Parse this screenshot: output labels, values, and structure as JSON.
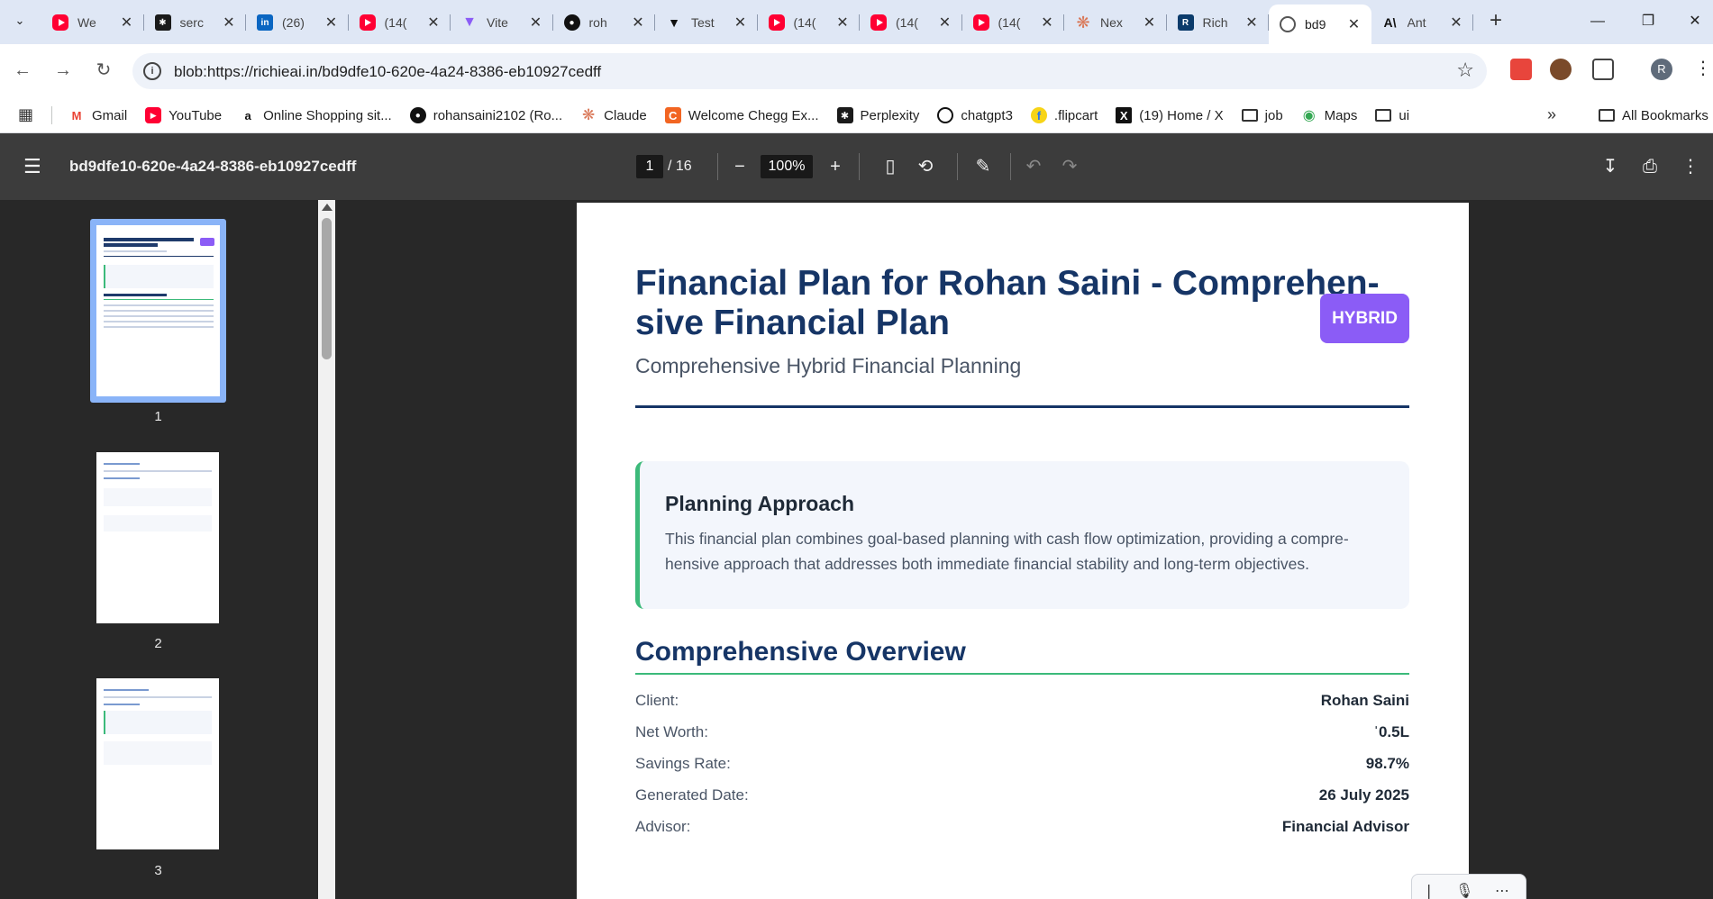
{
  "tabs": [
    {
      "title": "We",
      "icon": "youtube-icon"
    },
    {
      "title": "serc",
      "icon": "perplexity-icon"
    },
    {
      "title": "(26)",
      "icon": "linkedin-icon"
    },
    {
      "title": "(14(",
      "icon": "youtube-icon"
    },
    {
      "title": "Vite",
      "icon": "vite-icon"
    },
    {
      "title": "roh",
      "icon": "github-icon"
    },
    {
      "title": "Test",
      "icon": "test-icon"
    },
    {
      "title": "(14(",
      "icon": "youtube-icon"
    },
    {
      "title": "(14(",
      "icon": "youtube-icon"
    },
    {
      "title": "(14(",
      "icon": "youtube-icon"
    },
    {
      "title": "Nex",
      "icon": "claude-icon"
    },
    {
      "title": "Rich",
      "icon": "richieai-icon"
    },
    {
      "title": "bd9",
      "icon": "globe-icon",
      "active": true
    },
    {
      "title": "Ant",
      "icon": "anthropic-icon"
    }
  ],
  "address_bar": {
    "url": "blob:https://richieai.in/bd9dfe10-620e-4a24-8386-eb10927cedff"
  },
  "bookmarks": [
    {
      "label": "Gmail",
      "icon": "gmail-icon"
    },
    {
      "label": "YouTube",
      "icon": "youtube-icon"
    },
    {
      "label": "Online Shopping sit...",
      "icon": "amazon-icon"
    },
    {
      "label": "rohansaini2102 (Ro...",
      "icon": "github-icon"
    },
    {
      "label": "Claude",
      "icon": "claude-icon"
    },
    {
      "label": "Welcome Chegg Ex...",
      "icon": "chegg-icon"
    },
    {
      "label": "Perplexity",
      "icon": "perplexity-icon"
    },
    {
      "label": "chatgpt3",
      "icon": "openai-icon"
    },
    {
      "label": ".flipcart",
      "icon": "flipkart-icon"
    },
    {
      "label": "(19) Home / X",
      "icon": "x-icon"
    },
    {
      "label": "job",
      "icon": "folder-icon"
    },
    {
      "label": "Maps",
      "icon": "maps-icon"
    },
    {
      "label": "ui",
      "icon": "folder-icon"
    }
  ],
  "all_bookmarks_label": "All Bookmarks",
  "profile_initial": "R",
  "pdf_viewer": {
    "file_title": "bd9dfe10-620e-4a24-8386-eb10927cedff",
    "current_page": "1",
    "total_pages": "/ 16",
    "zoom": "100%"
  },
  "thumbnails": [
    {
      "number": "1",
      "selected": true
    },
    {
      "number": "2",
      "selected": false
    },
    {
      "number": "3",
      "selected": false
    }
  ],
  "document": {
    "title": "Financial Plan for Rohan Saini - Comprehen-sive Financial Plan",
    "badge": "HYBRID",
    "subtitle": "Comprehensive Hybrid Financial Planning",
    "approach_heading": "Planning Approach",
    "approach_text": "This financial plan combines goal-based planning with cash flow optimization, providing a compre-hensive approach that addresses both immediate financial stability and long-term objectives.",
    "overview_heading": "Comprehensive Overview",
    "overview": [
      {
        "label": "Client:",
        "value": "Rohan Saini"
      },
      {
        "label": "Net Worth:",
        "value": "ˈ0.5L"
      },
      {
        "label": "Savings Rate:",
        "value": "98.7%"
      },
      {
        "label": "Generated Date:",
        "value": "26 July 2025"
      },
      {
        "label": "Advisor:",
        "value": "Financial Advisor"
      }
    ]
  },
  "colors": {
    "tabstrip_bg": "#dfe7f5",
    "pdf_toolbar_bg": "#3c3c3c",
    "viewer_bg": "#282828",
    "heading_navy": "#163566",
    "accent_green": "#3cba7a",
    "badge_purple": "#8b5cf6",
    "thumb_selected": "#8ab4f8"
  }
}
